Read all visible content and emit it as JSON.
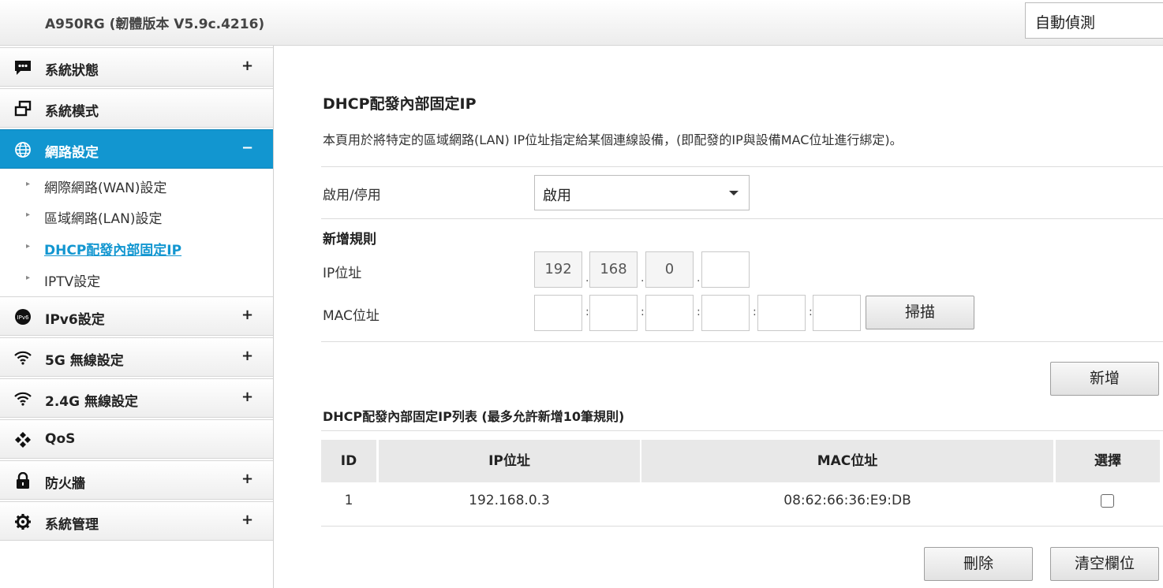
{
  "header": {
    "firmware_title": "A950RG (韌體版本 V5.9c.4216)",
    "language": "自動偵測"
  },
  "sidebar": {
    "items": [
      {
        "label": "系統狀態",
        "icon": "chat-bubble-icon",
        "toggle": "+"
      },
      {
        "label": "系統模式",
        "icon": "windows-icon",
        "toggle": "+"
      },
      {
        "label": "網路設定",
        "icon": "globe-icon",
        "toggle": "−",
        "active": true
      },
      {
        "label": "IPv6設定",
        "icon": "ipv6-icon",
        "toggle": "+"
      },
      {
        "label": "5G 無線設定",
        "icon": "wifi-icon",
        "toggle": "+"
      },
      {
        "label": "2.4G 無線設定",
        "icon": "wifi-icon",
        "toggle": "+"
      },
      {
        "label": "QoS",
        "icon": "qos-icon",
        "toggle": ""
      },
      {
        "label": "防火牆",
        "icon": "lock-icon",
        "toggle": "+"
      },
      {
        "label": "系統管理",
        "icon": "gear-icon",
        "toggle": "+"
      }
    ],
    "subitems": [
      {
        "label": "網際網路(WAN)設定"
      },
      {
        "label": "區域網路(LAN)設定"
      },
      {
        "label": "DHCP配發內部固定IP",
        "current": true
      },
      {
        "label": "IPTV設定"
      }
    ]
  },
  "main": {
    "title": "DHCP配發內部固定IP",
    "description": "本頁用於將特定的區域網路(LAN) IP位址指定給某個連線設備，(即配發的IP與設備MAC位址進行綁定)。",
    "enable_label": "啟用/停用",
    "enable_value": "啟用",
    "add_rule_title": "新增規則",
    "ip_label": "IP位址",
    "ip_octets": [
      "192",
      "168",
      "0",
      ""
    ],
    "mac_label": "MAC位址",
    "mac_octets": [
      "",
      "",
      "",
      "",
      "",
      ""
    ],
    "scan_button": "掃描",
    "add_button": "新增",
    "list_title": "DHCP配發內部固定IP列表 (最多允許新增10筆規則)",
    "table": {
      "headers": [
        "ID",
        "IP位址",
        "MAC位址",
        "選擇"
      ],
      "rows": [
        {
          "id": "1",
          "ip": "192.168.0.3",
          "mac": "08:62:66:36:E9:DB",
          "selected": false
        }
      ]
    },
    "delete_button": "刪除",
    "clear_button": "清空欄位"
  }
}
